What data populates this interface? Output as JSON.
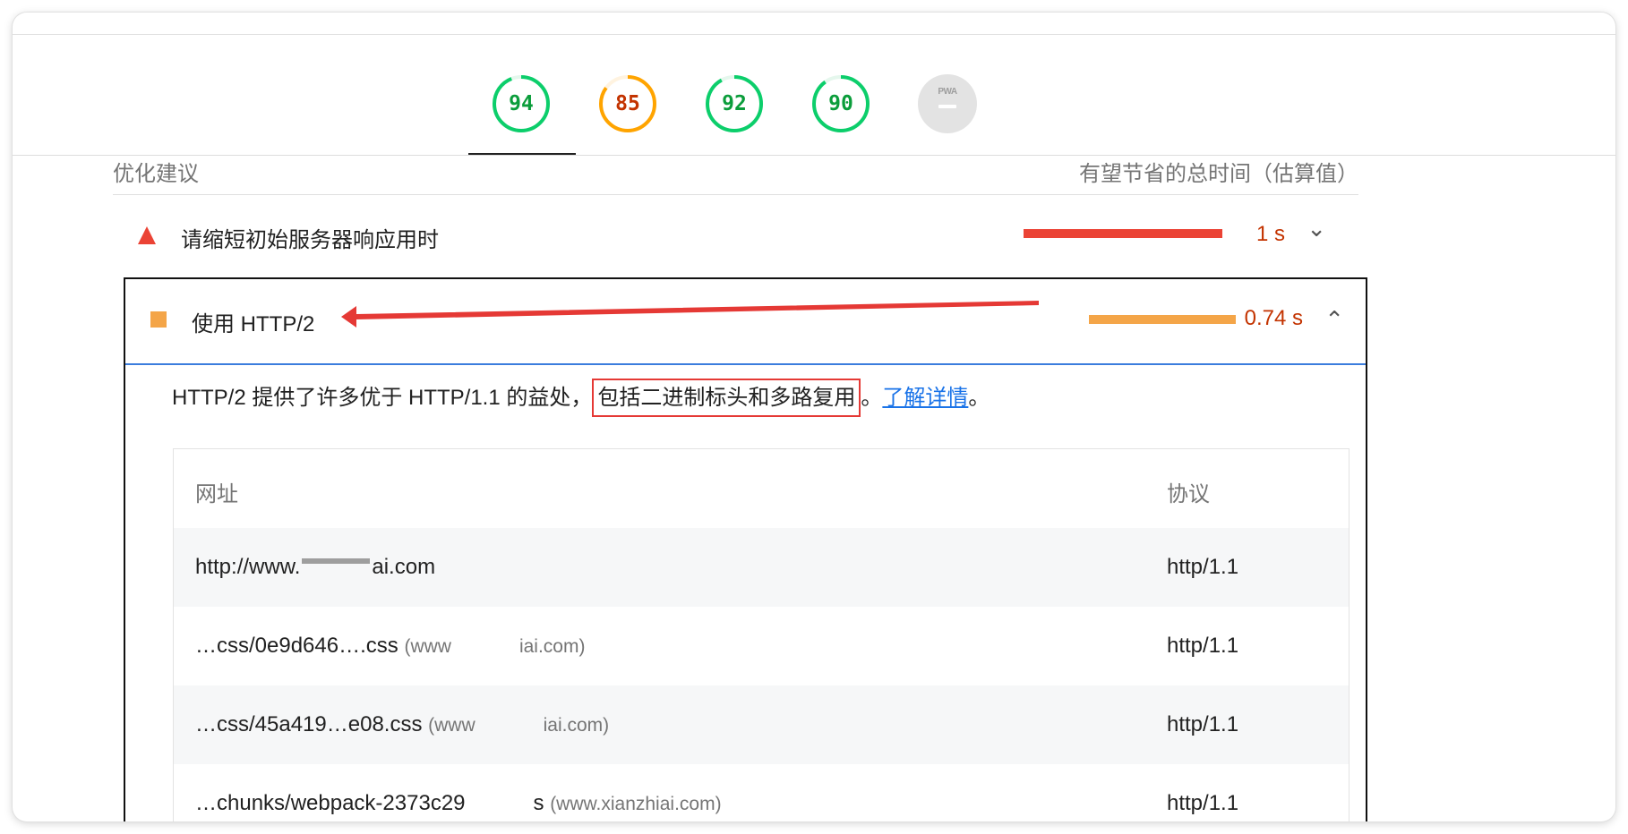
{
  "scores": [
    {
      "value": "94",
      "fraction": 0.94,
      "color": "#0b9d3b",
      "ring": "#0cce6b"
    },
    {
      "value": "85",
      "fraction": 0.85,
      "color": "#c33300",
      "ring": "#ffa400"
    },
    {
      "value": "92",
      "fraction": 0.92,
      "color": "#0b9d3b",
      "ring": "#0cce6b"
    },
    {
      "value": "90",
      "fraction": 0.9,
      "color": "#0b9d3b",
      "ring": "#0cce6b"
    }
  ],
  "pwa": {
    "label": "PWA",
    "value": "—"
  },
  "section": {
    "title": "优化建议",
    "savings_header": "有望节省的总时间（估算值）"
  },
  "opportunities": [
    {
      "title": "请缩短初始服务器响应用时",
      "value": "1 s",
      "fraction": 1.0,
      "bar_color": "#eb4335",
      "value_color": "#c33300",
      "chevron": "⌄"
    },
    {
      "title": "使用 HTTP/2",
      "value": "0.74 s",
      "fraction": 0.74,
      "bar_color": "#f4a548",
      "value_color": "#c33300",
      "chevron": "⌃"
    }
  ],
  "details": {
    "desc_prefix": "HTTP/2 提供了许多优于 HTTP/1.1 的益处，",
    "desc_highlight": "包括二进制标头和多路复用",
    "desc_mid": "。",
    "desc_link": "了解详情",
    "desc_suffix": "。"
  },
  "table": {
    "headers": [
      "网址",
      "协议"
    ],
    "rows": [
      {
        "url_a": "http://www.",
        "url_b": "ai.com",
        "domain": "",
        "protocol": "http/1.1"
      },
      {
        "url_a": "…css/0e9d646….css",
        "url_b": "",
        "domain": "(www",
        "domain_b": "iai.com)",
        "protocol": "http/1.1"
      },
      {
        "url_a": "…css/45a419…e08.css",
        "url_b": "",
        "domain": "(www",
        "domain_b": "iai.com)",
        "protocol": "http/1.1"
      },
      {
        "url_a": "…chunks/webpack-2373c29",
        "url_b": "s",
        "domain": "(www.xianzhiai.com)",
        "protocol": "http/1.1"
      }
    ]
  }
}
